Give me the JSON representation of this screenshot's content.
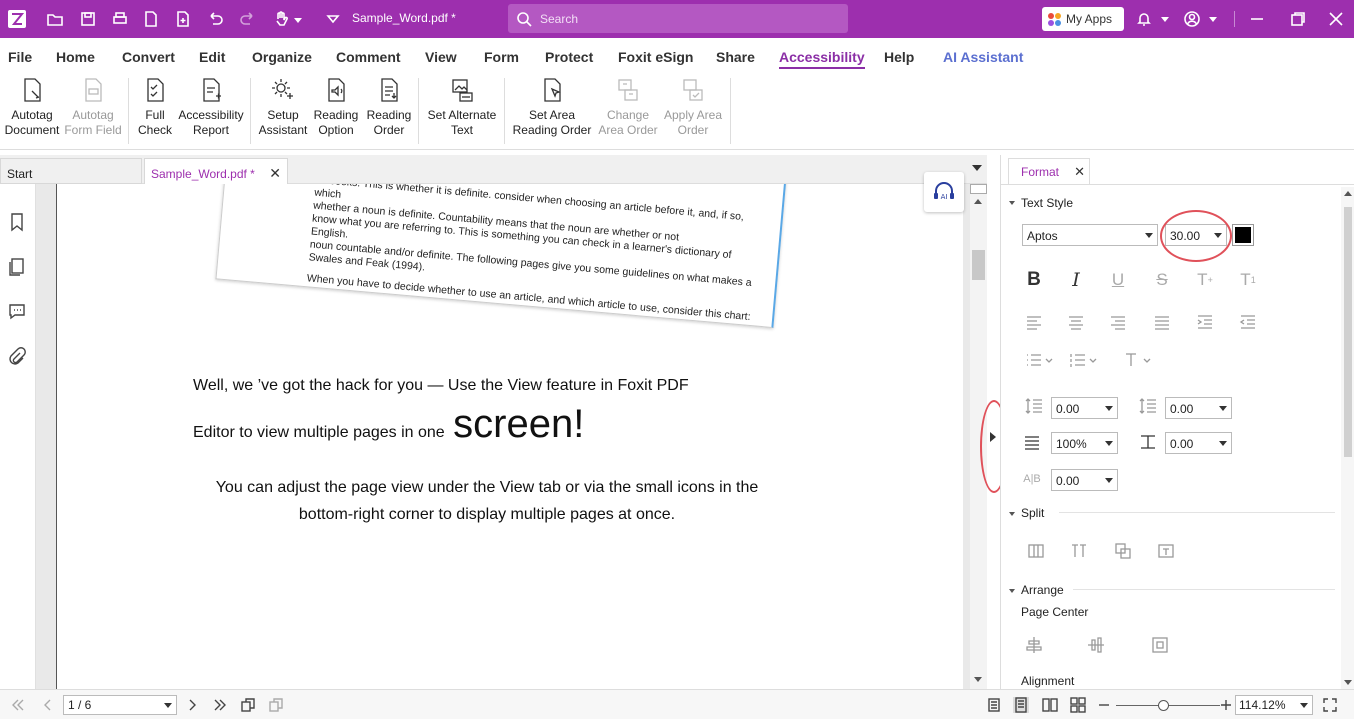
{
  "titlebar": {
    "doc_title": "Sample_Word.pdf *",
    "search_placeholder": "Search",
    "my_apps": "My Apps"
  },
  "menu": [
    "File",
    "Home",
    "Convert",
    "Edit",
    "Organize",
    "Comment",
    "View",
    "Form",
    "Protect",
    "Foxit eSign",
    "Share",
    "Accessibility",
    "Help",
    "AI Assistant"
  ],
  "menu_active": "Accessibility",
  "ribbon": {
    "autotag_document": [
      "Autotag",
      "Document"
    ],
    "autotag_form_field": [
      "Autotag",
      "Form Field"
    ],
    "full_check": [
      "Full",
      "Check"
    ],
    "accessibility_report": [
      "Accessibility",
      "Report"
    ],
    "setup_assistant": [
      "Setup",
      "Assistant"
    ],
    "reading_option": [
      "Reading",
      "Option"
    ],
    "reading_order": [
      "Reading",
      "Order"
    ],
    "set_alternate_text": [
      "Set Alternate",
      "Text"
    ],
    "set_area_reading_order": [
      "Set Area",
      "Reading Order"
    ],
    "change_area_order": [
      "Change",
      "Area Order"
    ],
    "apply_area_order": [
      "Apply Area",
      "Order"
    ]
  },
  "tabs": {
    "start": "Start",
    "document": "Sample_Word.pdf *"
  },
  "document": {
    "snippet_lines": [
      "ok/books. This is whether it is definite. consider when choosing an article before it, and, if so, which",
      "whether a noun is definite. Countability means that the noun are whether or not",
      "know what you are referring to. This is something you can check in a learner's dictionary of English.",
      "noun countable and/or definite. The following pages give you some guidelines on what makes a",
      "Swales and Feak (1994).",
      "When you have to decide whether to use an article, and which article to use, consider this chart:"
    ],
    "line1": "Well, we ’ve got the hack for you — Use the View feature in Foxit PDF",
    "line2": "Editor to view multiple pages in one",
    "big_word": "screen!",
    "para_line1": "You can adjust the page view under the View tab or via the small icons in the",
    "para_line2": "bottom-right corner to display multiple pages at once."
  },
  "format_panel": {
    "tab": "Format",
    "text_style": "Text Style",
    "font": "Aptos",
    "font_size": "30.00",
    "font_color": "#000000",
    "spacing_before": "0.00",
    "spacing_after": "0.00",
    "line_spacing": "100%",
    "indent": "0.00",
    "char_spacing": "0.00",
    "split": "Split",
    "arrange": "Arrange",
    "page_center": "Page Center",
    "alignment": "Alignment"
  },
  "status": {
    "page": "1 / 6",
    "zoom": "114.12%"
  },
  "colors": {
    "brand": "#9d2fae",
    "accent_blue": "#5b6fd0",
    "highlight": "#e0515a"
  }
}
